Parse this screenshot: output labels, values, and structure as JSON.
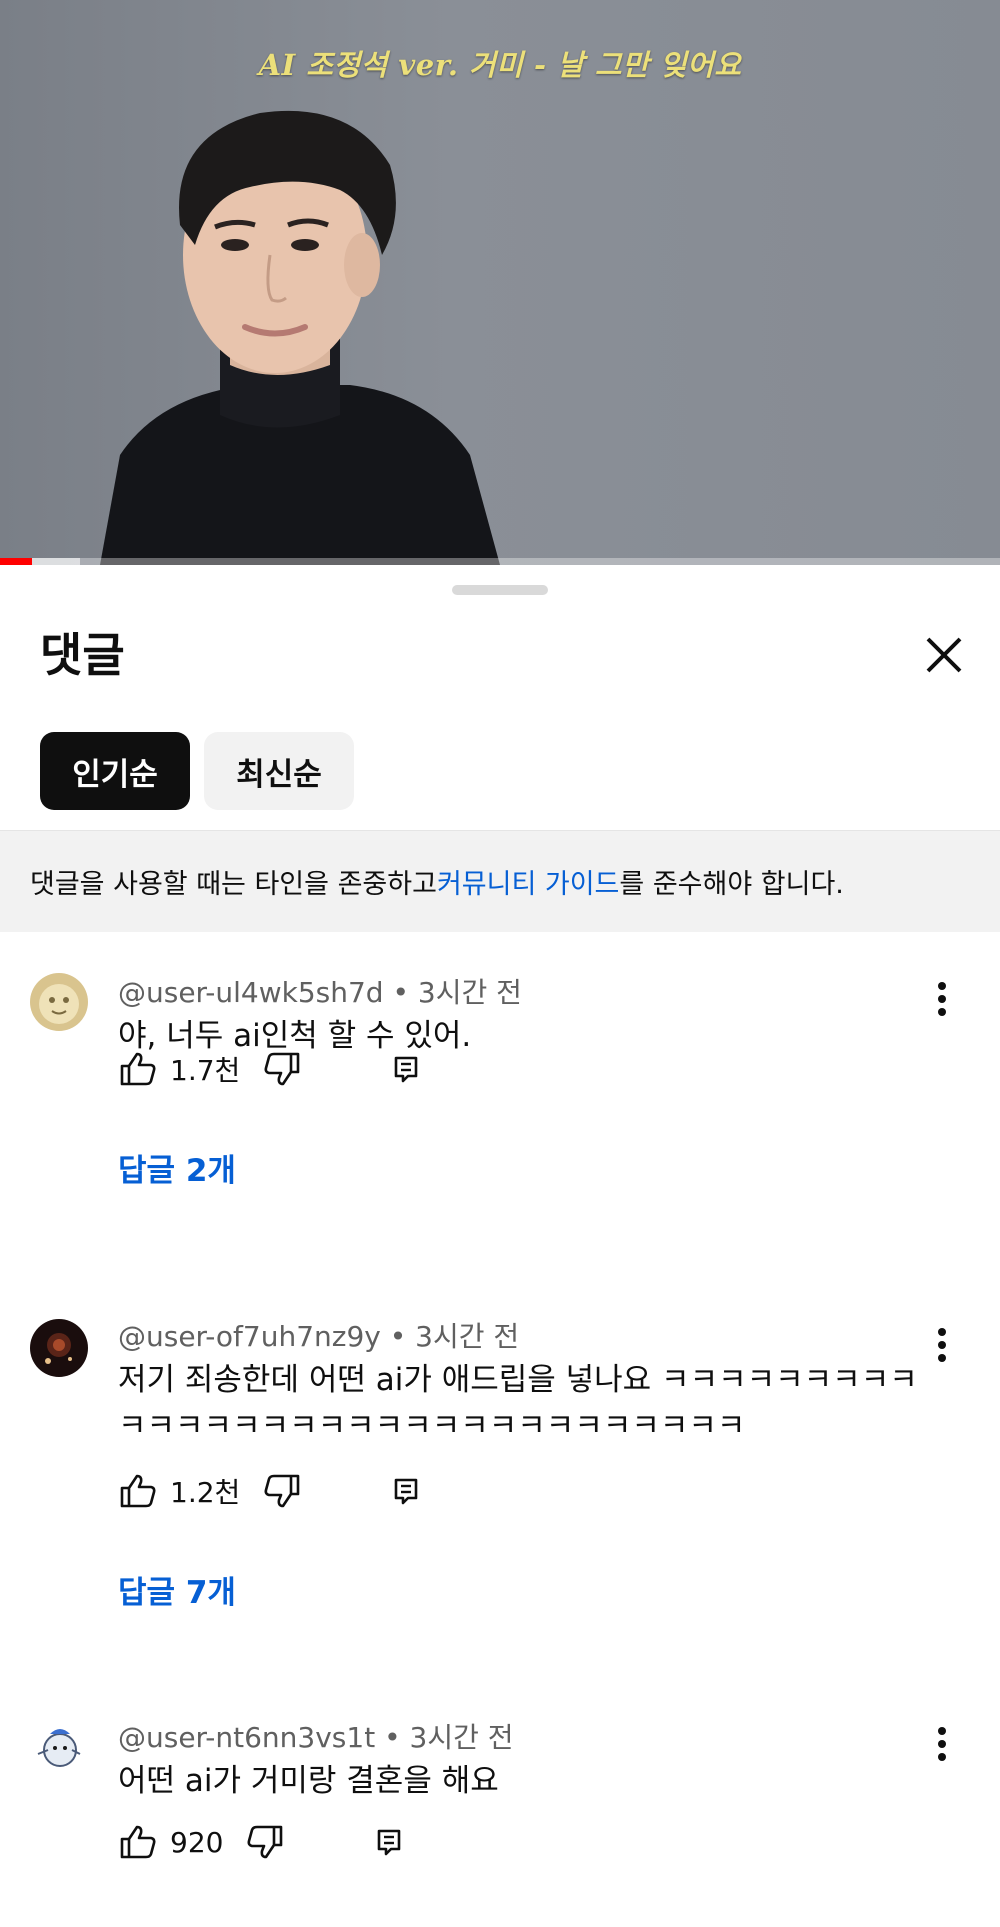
{
  "video": {
    "caption": "AI 조정석 ver. 거미 - 날 그만 잊어요",
    "progress_fraction": 0.032,
    "buffered_fraction": 0.08
  },
  "sheet": {
    "title": "댓글",
    "close_icon": "close-icon",
    "sort_chips": [
      {
        "label": "인기순",
        "selected": true
      },
      {
        "label": "최신순",
        "selected": false
      }
    ],
    "notice": {
      "before": "댓글을 사용할 때는 타인을 존중하고 ",
      "link": "커뮤니티 가이드",
      "after": "를 준수해야 합니다."
    }
  },
  "comments": [
    {
      "author": "@user-ul4wk5sh7d",
      "time": "• 3시간 전",
      "text": "야, 너두 ai인척 할 수 있어.",
      "likes": "1.7천",
      "replies": "답글 2개"
    },
    {
      "author": "@user-of7uh7nz9y",
      "time": "• 3시간 전",
      "text": "저기 죄송한데 어떤 ai가 애드립을 넣나요 ㅋㅋㅋㅋㅋㅋㅋㅋㅋㅋㅋㅋㅋㅋㅋㅋㅋㅋㅋㅋㅋㅋㅋㅋㅋㅋㅋㅋㅋㅋㅋ",
      "likes": "1.2천",
      "replies": "답글 7개"
    },
    {
      "author": "@user-nt6nn3vs1t",
      "time": "• 3시간 전",
      "text": "어떤 ai가 거미랑 결혼을 해요",
      "likes": "920"
    }
  ],
  "colors": {
    "link_blue": "#065fd4",
    "progress_red": "#ff0000",
    "caption_yellow": "#ece07a"
  }
}
